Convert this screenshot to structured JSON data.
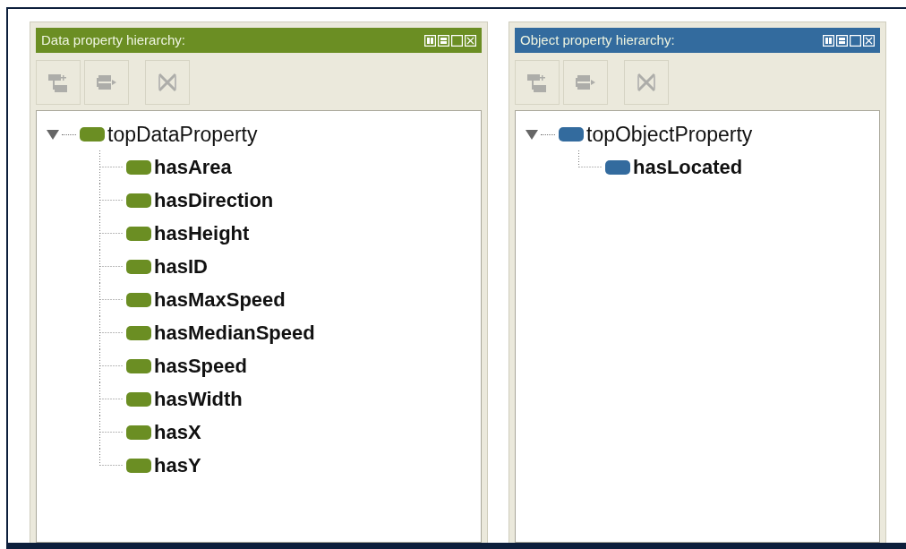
{
  "panels": [
    {
      "title": "Data property hierarchy:",
      "color": "#6b8e23",
      "toolbar": [
        {
          "kind": "add-child",
          "disabled": true
        },
        {
          "kind": "add-sibling",
          "disabled": true
        },
        {
          "kind": "delete",
          "disabled": true
        }
      ],
      "tree": [
        {
          "label": "topDataProperty",
          "expanded": true,
          "children": [
            {
              "label": "hasArea"
            },
            {
              "label": "hasDirection"
            },
            {
              "label": "hasHeight"
            },
            {
              "label": "hasID"
            },
            {
              "label": "hasMaxSpeed"
            },
            {
              "label": "hasMedianSpeed"
            },
            {
              "label": "hasSpeed"
            },
            {
              "label": "hasWidth"
            },
            {
              "label": "hasX"
            },
            {
              "label": "hasY"
            }
          ]
        }
      ]
    },
    {
      "title": "Object property hierarchy:",
      "color": "#336b9e",
      "toolbar": [
        {
          "kind": "add-child",
          "disabled": true
        },
        {
          "kind": "add-sibling",
          "disabled": true
        },
        {
          "kind": "delete",
          "disabled": true
        }
      ],
      "tree": [
        {
          "label": "topObjectProperty",
          "expanded": true,
          "children": [
            {
              "label": "hasLocated"
            }
          ]
        }
      ]
    }
  ]
}
